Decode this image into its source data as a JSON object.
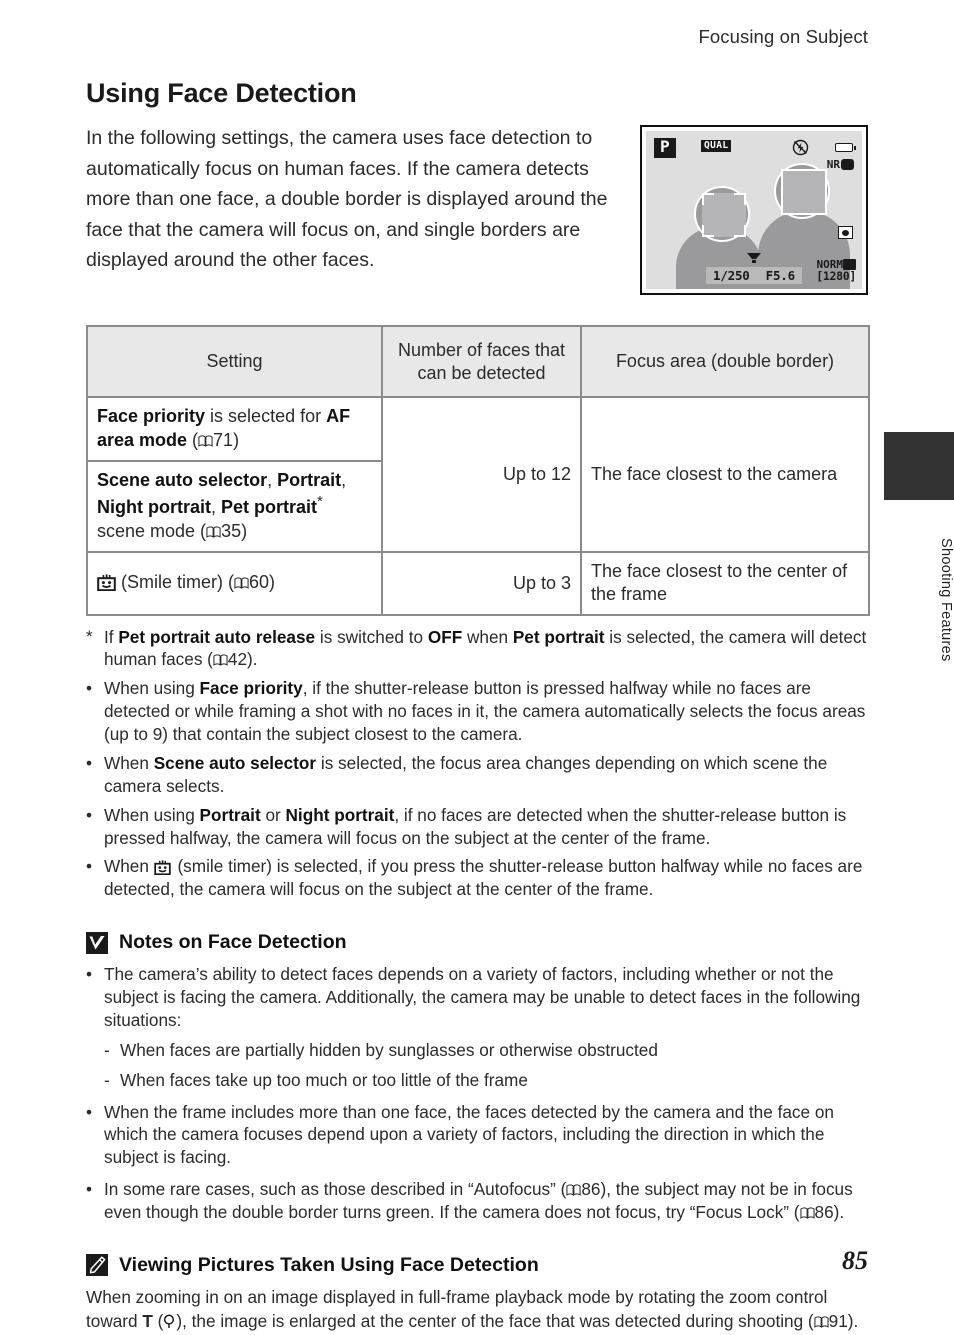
{
  "running_head": "Focusing on Subject",
  "side_tab": {
    "label": "Shooting Features"
  },
  "page_number": "85",
  "title": "Using Face Detection",
  "intro": "In the following settings, the camera uses face detection to automatically focus on human faces. If the camera detects more than one face, a double border is displayed around the face that the camera will focus on, and single borders are displayed around the other faces.",
  "lcd": {
    "mode": "P",
    "quality": "QUAL",
    "nr": "NR",
    "norm": "NORM",
    "shutter_speed": "1/250",
    "aperture": "F5.6",
    "frames_remaining": "[1280]",
    "icons": [
      "flash-off-icon",
      "battery-icon",
      "nr-blur-icon",
      "metering-icon",
      "movie-icon",
      "macro-icon"
    ]
  },
  "table": {
    "headers": [
      "Setting",
      "Number of faces that can be detected",
      "Focus area (double border)"
    ],
    "rows": [
      {
        "setting_html": "<b>Face priority</b> is selected for <b>AF area mode</b> (BK71)",
        "setting_plain": "Face priority is selected for AF area mode (71)",
        "count": "",
        "focus": ""
      },
      {
        "setting_html": "<b>Scene auto selector</b>, <b>Portrait</b>, <b>Night portrait</b>, <b>Pet portrait</b>* scene mode (BK35)",
        "setting_plain": "Scene auto selector, Portrait, Night portrait, Pet portrait* scene mode (35)",
        "count": "Up to 12",
        "focus": "The face closest to the camera"
      },
      {
        "setting_html": "SMILE (Smile timer) (BK60)",
        "setting_plain": "(Smile timer) (60)",
        "count": "Up to 3",
        "focus": "The face closest to the center of the frame"
      }
    ]
  },
  "footnotes": [
    {
      "marker": "*",
      "text": "If Pet portrait auto release is switched to OFF when Pet portrait is selected, the camera will detect human faces (42)."
    },
    {
      "marker": "•",
      "text": "When using Face priority, if the shutter-release button is pressed halfway while no faces are detected or while framing a shot with no faces in it, the camera automatically selects the focus areas (up to 9) that contain the subject closest to the camera."
    },
    {
      "marker": "•",
      "text": "When Scene auto selector is selected, the focus area changes depending on which scene the camera selects."
    },
    {
      "marker": "•",
      "text": "When using Portrait or Night portrait, if no faces are detected when the shutter-release button is pressed halfway, the camera will focus on the subject at the center of the frame."
    },
    {
      "marker": "•",
      "text": "When (smile timer) is selected, if you press the shutter-release button halfway while no faces are detected, the camera will focus on the subject at the center of the frame."
    }
  ],
  "notes_section": {
    "icon": "caution-checkmark-icon",
    "heading": "Notes on Face Detection",
    "bullets": [
      "The camera’s ability to detect faces depends on a variety of factors, including whether or not the subject is facing the camera. Additionally, the camera may be unable to detect faces in the following situations:",
      "When the frame includes more than one face, the faces detected by the camera and the face on which the camera focuses depend upon a variety of factors, including the direction in which the subject is facing.",
      "In some rare cases, such as those described in “Autofocus” (86), the subject may not be in focus even though the double border turns green. If the camera does not focus, try “Focus Lock” (86)."
    ],
    "sub_bullets": [
      "When faces are partially hidden by sunglasses or otherwise obstructed",
      "When faces take up too much or too little of the frame"
    ]
  },
  "viewing_section": {
    "icon": "pencil-note-icon",
    "heading": "Viewing Pictures Taken Using Face Detection",
    "paragraph": "When zooming in on an image displayed in full-frame playback mode by rotating the zoom control toward T (MAG), the image is enlarged at the center of the face that was detected during shooting (91)."
  },
  "page_refs": {
    "af_area_mode": "71",
    "scene_mode": "35",
    "smile_timer": "60",
    "pet_portrait": "42",
    "autofocus": "86",
    "focus_lock": "86",
    "playback_zoom": "91"
  }
}
